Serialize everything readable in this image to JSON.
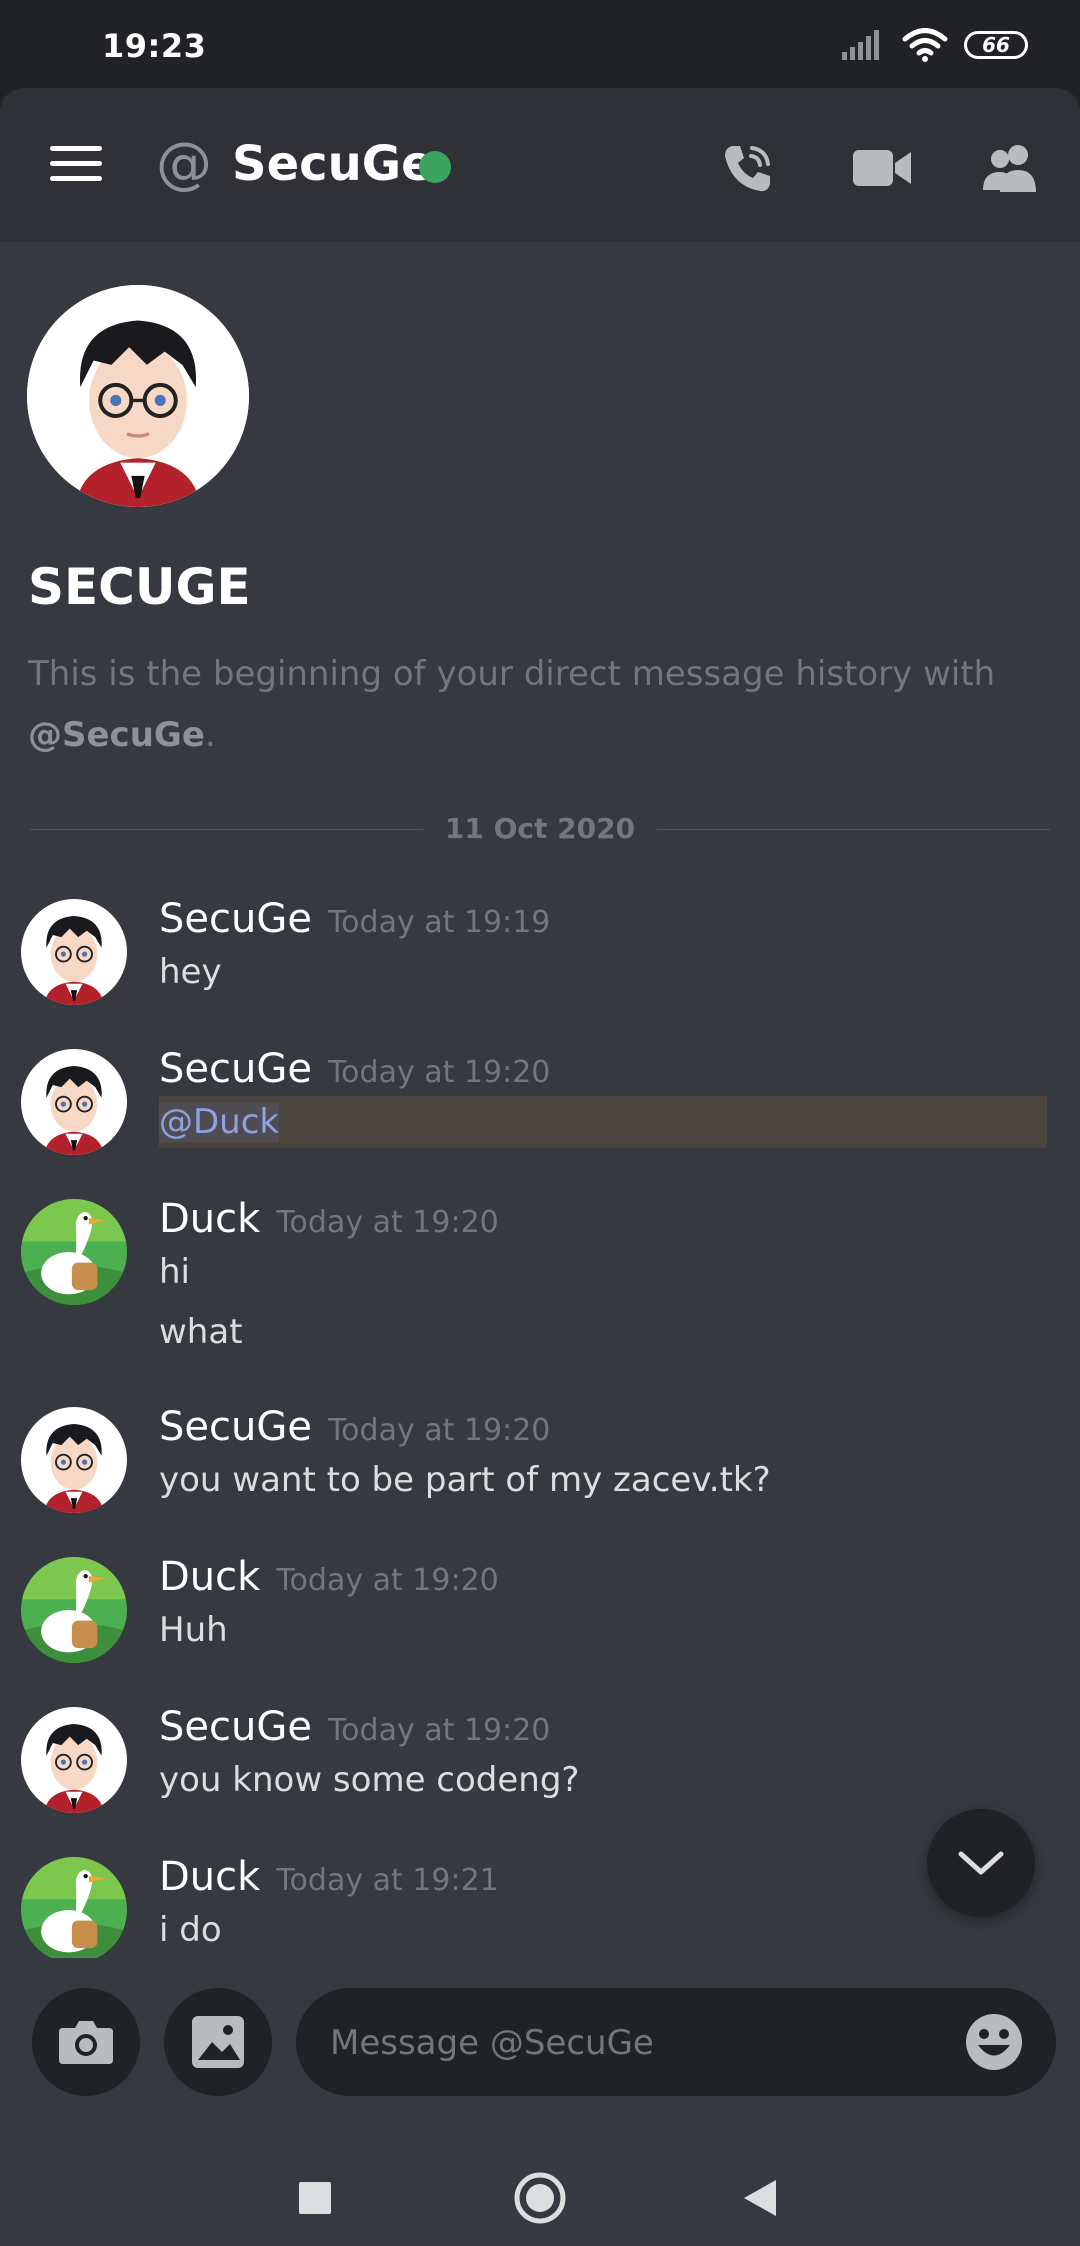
{
  "status_bar": {
    "time": "19:23",
    "battery": "66"
  },
  "header": {
    "title": "SecuGe",
    "at_symbol": "@"
  },
  "intro": {
    "name": "SECUGE",
    "text_prefix": "This is the beginning of your direct message history with",
    "mention": "@SecuGe",
    "text_suffix": "."
  },
  "date_divider": "11 Oct 2020",
  "messages": [
    {
      "author": "SecuGe",
      "time": "Today at 19:19",
      "lines": [
        "hey"
      ]
    },
    {
      "author": "SecuGe",
      "time": "Today at 19:20",
      "mention": "@Duck"
    },
    {
      "author": "Duck",
      "time": "Today at 19:20",
      "lines": [
        "hi",
        "what"
      ]
    },
    {
      "author": "SecuGe",
      "time": "Today at 19:20",
      "lines": [
        "you want to be part of my zacev.tk?"
      ]
    },
    {
      "author": "Duck",
      "time": "Today at 19:20",
      "lines": [
        "Huh"
      ]
    },
    {
      "author": "SecuGe",
      "time": "Today at 19:20",
      "lines": [
        "you know some codeng?"
      ]
    },
    {
      "author": "Duck",
      "time": "Today at 19:21",
      "lines": [
        "i do"
      ]
    }
  ],
  "composer": {
    "placeholder": "Message @SecuGe"
  },
  "icons": {
    "menu": "hamburger-icon",
    "call": "phone-call-icon",
    "video": "video-camera-icon",
    "members": "members-icon",
    "camera": "camera-icon",
    "image": "image-icon",
    "emoji": "emoji-icon",
    "scroll": "chevron-down-icon"
  },
  "colors": {
    "online": "#3ba55d",
    "mention": "#8ea1e1",
    "mention_highlight": "#49443c"
  }
}
